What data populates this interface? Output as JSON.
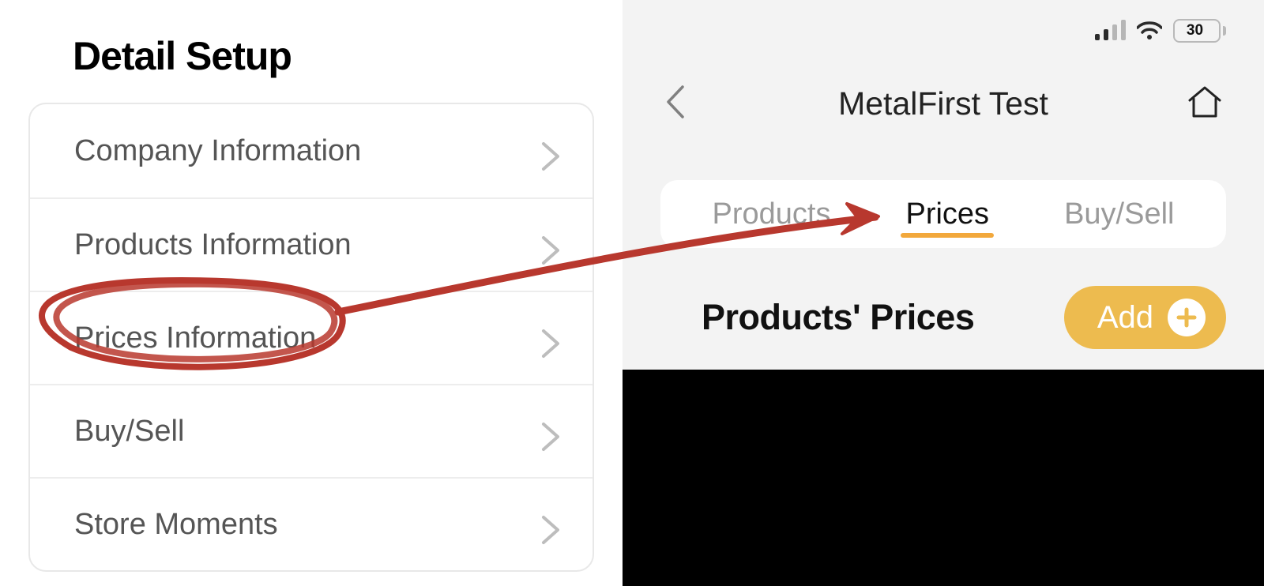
{
  "left": {
    "title": "Detail Setup",
    "items": [
      {
        "label": "Company Information"
      },
      {
        "label": "Products Information"
      },
      {
        "label": "Prices Information"
      },
      {
        "label": "Buy/Sell"
      },
      {
        "label": "Store Moments"
      }
    ]
  },
  "right": {
    "statusbar": {
      "battery_percent": "30"
    },
    "nav_title": "MetalFirst Test",
    "tabs": [
      {
        "label": "Products",
        "active": false
      },
      {
        "label": "Prices",
        "active": true
      },
      {
        "label": "Buy/Sell",
        "active": false
      }
    ],
    "section_title": "Products' Prices",
    "add_label": "Add"
  },
  "colors": {
    "accent_orange": "#f2a83c",
    "accent_yellow": "#edbb4f",
    "annotation_red": "#c0392b"
  }
}
